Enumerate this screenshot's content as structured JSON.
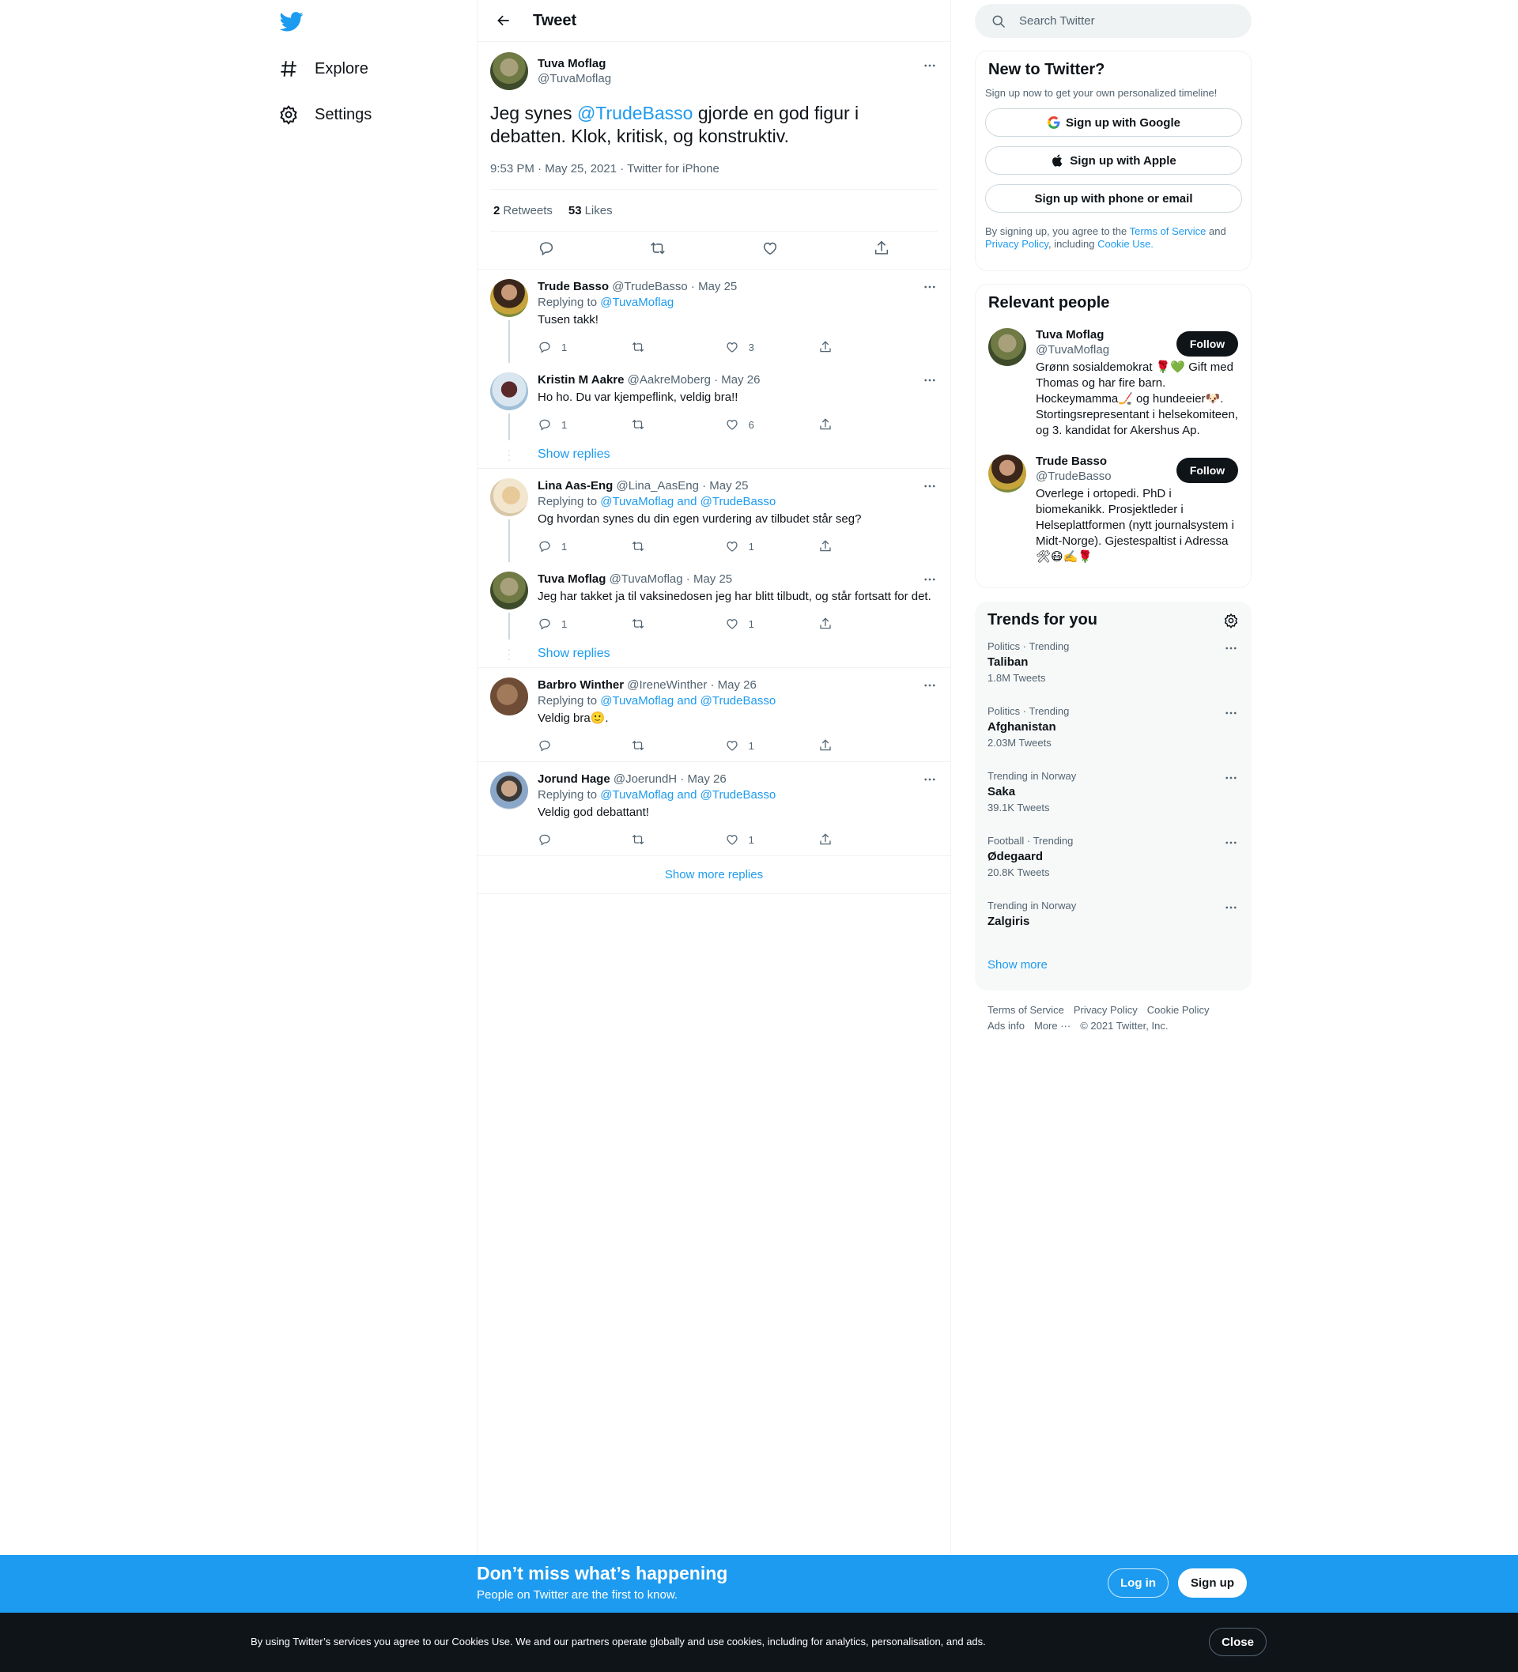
{
  "nav": {
    "explore_label": "Explore",
    "settings_label": "Settings"
  },
  "header": {
    "title": "Tweet"
  },
  "focal_tweet": {
    "author_name": "Tuva Moflag",
    "author_handle": "@TuvaMoflag",
    "text_before": "Jeg synes ",
    "mention": "@TrudeBasso",
    "text_after": " gjorde en god figur i debatten. Klok, kritisk, og konstruktiv.",
    "meta": "9:53 PM · May 25, 2021 · Twitter for iPhone",
    "retweets_count": "2",
    "retweets_label": "Retweets",
    "likes_count": "53",
    "likes_label": "Likes"
  },
  "replies": [
    {
      "name": "Trude Basso",
      "handle": "@TrudeBasso",
      "date": "· May 25",
      "replying_prefix": "Replying to ",
      "replying_to": "@TuvaMoflag",
      "text": "Tusen takk!",
      "reply_count": "1",
      "retweet_count": "",
      "like_count": "3"
    },
    {
      "name": "Kristin M Aakre",
      "handle": "@AakreMoberg",
      "date": "· May 26",
      "text": "Ho ho. Du var kjempeflink, veldig bra!!",
      "reply_count": "1",
      "retweet_count": "",
      "like_count": "6"
    },
    {
      "name": "Lina Aas-Eng",
      "handle": "@Lina_AasEng",
      "date": "· May 25",
      "replying_prefix": "Replying to ",
      "replying_to": "@TuvaMoflag and @TrudeBasso",
      "text": "Og hvordan synes du din egen vurdering av tilbudet står seg?",
      "reply_count": "1",
      "retweet_count": "",
      "like_count": "1"
    },
    {
      "name": "Tuva Moflag",
      "handle": "@TuvaMoflag",
      "date": "· May 25",
      "text": "Jeg har takket ja til vaksinedosen jeg har blitt tilbudt, og står fortsatt for det.",
      "reply_count": "1",
      "retweet_count": "",
      "like_count": "1"
    },
    {
      "name": "Barbro Winther",
      "handle": "@IreneWinther",
      "date": "· May 26",
      "replying_prefix": "Replying to ",
      "replying_to": "@TuvaMoflag and @TrudeBasso",
      "text": "Veldig bra🙂.",
      "reply_count": "",
      "retweet_count": "",
      "like_count": "1"
    },
    {
      "name": "Jorund Hage",
      "handle": "@JoerundH",
      "date": "· May 26",
      "replying_prefix": "Replying to ",
      "replying_to": "@TuvaMoflag and @TrudeBasso",
      "text": "Veldig god debattant!",
      "reply_count": "",
      "retweet_count": "",
      "like_count": "1"
    }
  ],
  "show_replies_label": "Show replies",
  "show_more_replies_label": "Show more replies",
  "search": {
    "placeholder": "Search Twitter"
  },
  "new_to_twitter": {
    "title": "New to Twitter?",
    "subtitle": "Sign up now to get your own personalized timeline!",
    "google_label": "Sign up with Google",
    "apple_label": "Sign up with Apple",
    "phone_label": "Sign up with phone or email",
    "terms_prefix": "By signing up, you agree to the ",
    "terms_link": "Terms of Service",
    "terms_and": " and ",
    "privacy_link": "Privacy Policy",
    "terms_including": ", including ",
    "cookie_link": "Cookie Use."
  },
  "relevant_people": {
    "title": "Relevant people",
    "follow_label": "Follow",
    "people": [
      {
        "name": "Tuva Moflag",
        "handle": "@TuvaMoflag",
        "bio": "Grønn sosialdemokrat 🌹💚 Gift med Thomas og har fire barn. Hockeymamma🏒 og hundeeier🐶. Stortingsrepresentant i helsekomiteen, og 3. kandidat for Akershus Ap."
      },
      {
        "name": "Trude Basso",
        "handle": "@TrudeBasso",
        "bio": "Overlege i ortopedi. PhD i biomekanikk. Prosjektleder i Helseplattformen (nytt journalsystem i Midt-Norge). Gjestespaltist i Adressa 🛠😷✍️🌹"
      }
    ]
  },
  "trends": {
    "title": "Trends for you",
    "items": [
      {
        "category": "Politics · Trending",
        "name": "Taliban",
        "count": "1.8M Tweets"
      },
      {
        "category": "Politics · Trending",
        "name": "Afghanistan",
        "count": "2.03M Tweets"
      },
      {
        "category": "Trending in Norway",
        "name": "Saka",
        "count": "39.1K Tweets"
      },
      {
        "category": "Football · Trending",
        "name": "Ødegaard",
        "count": "20.8K Tweets"
      },
      {
        "category": "Trending in Norway",
        "name": "Zalgiris",
        "count": ""
      }
    ],
    "show_more_label": "Show more"
  },
  "footer": {
    "terms": "Terms of Service",
    "privacy": "Privacy Policy",
    "cookie": "Cookie Policy",
    "ads": "Ads info",
    "more": "More ···",
    "copyright": "© 2021 Twitter, Inc."
  },
  "banner": {
    "title": "Don’t miss what’s happening",
    "subtitle": "People on Twitter are the first to know.",
    "login_label": "Log in",
    "signup_label": "Sign up"
  },
  "cookie_bar": {
    "text": "By using Twitter’s services you agree to our Cookies Use. We and our partners operate globally and use cookies, including for analytics, personalisation, and ads.",
    "close_label": "Close"
  },
  "colors": {
    "accent": "#1d9bf0",
    "text": "#0f1419",
    "muted": "#536471",
    "cookie_bg": "#0f1419"
  }
}
